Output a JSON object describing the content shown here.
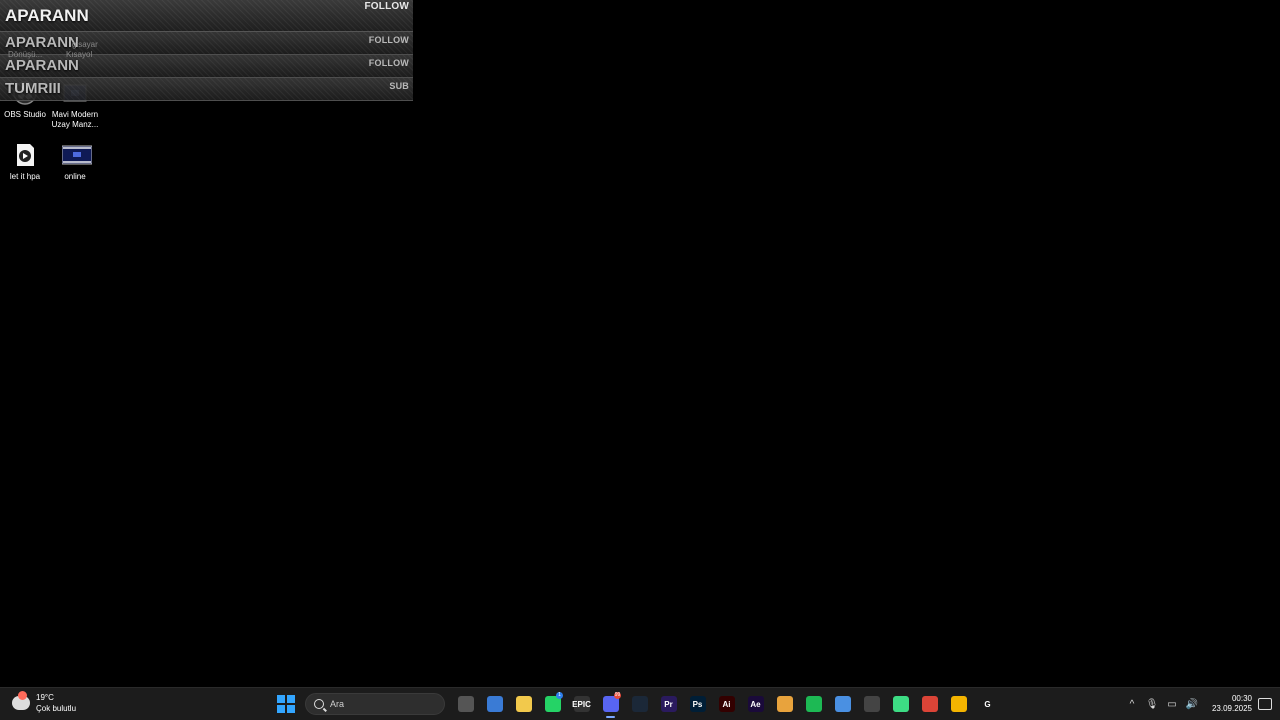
{
  "alerts": [
    {
      "name": "APARANN",
      "kind": "FOLLOW"
    },
    {
      "name": "APARANN",
      "kind": "FOLLOW"
    },
    {
      "name": "APARANN",
      "kind": "FOLLOW"
    },
    {
      "name": "TUMRIII",
      "kind": "SUB"
    }
  ],
  "ghost_labels": {
    "left": "Dönüşü...",
    "right": "Kısayol",
    "mid": "gisayar"
  },
  "desktop_icons": [
    {
      "label": "OBS Studio",
      "icon": "obs-icon"
    },
    {
      "label": "Mavi Modern Uzay Manz...",
      "icon": "video-file-icon"
    },
    {
      "label": "let it hpa",
      "icon": "media-file-icon"
    },
    {
      "label": "online",
      "icon": "video-file-icon"
    }
  ],
  "taskbar": {
    "weather": {
      "temp": "19°C",
      "desc": "Çok bulutlu"
    },
    "search_placeholder": "Ara",
    "apps": [
      {
        "name": "task-view",
        "icon": "task-view-icon",
        "text": "",
        "color": "#555555"
      },
      {
        "name": "store",
        "icon": "store-icon",
        "text": "",
        "color": "#3a7bd5"
      },
      {
        "name": "explorer",
        "icon": "folder-icon",
        "text": "",
        "color": "#f2c94c"
      },
      {
        "name": "whatsapp",
        "icon": "whatsapp-icon",
        "text": "",
        "color": "#25d366",
        "badge": "1"
      },
      {
        "name": "epic",
        "icon": "epic-games-icon",
        "text": "EPIC",
        "color": "#333333"
      },
      {
        "name": "discord",
        "icon": "discord-icon",
        "text": "",
        "color": "#5865f2",
        "badge": "99",
        "active": true
      },
      {
        "name": "steam",
        "icon": "steam-icon",
        "text": "",
        "color": "#1b2838"
      },
      {
        "name": "premiere",
        "icon": "premiere-icon",
        "text": "Pr",
        "color": "#2a1a5e"
      },
      {
        "name": "photoshop",
        "icon": "photoshop-icon",
        "text": "Ps",
        "color": "#001e36"
      },
      {
        "name": "illustrator",
        "icon": "illustrator-icon",
        "text": "Ai",
        "color": "#330000"
      },
      {
        "name": "aftereffects",
        "icon": "after-effects-icon",
        "text": "Ae",
        "color": "#1a0a3a"
      },
      {
        "name": "chrome-1",
        "icon": "chrome-icon",
        "text": "",
        "color": "#e8a33d"
      },
      {
        "name": "spotify",
        "icon": "spotify-icon",
        "text": "",
        "color": "#1db954"
      },
      {
        "name": "chrome-2",
        "icon": "chrome-icon",
        "text": "",
        "color": "#4a90e2"
      },
      {
        "name": "obs",
        "icon": "obs-icon",
        "text": "",
        "color": "#444444"
      },
      {
        "name": "app-green",
        "icon": "app-icon",
        "text": "",
        "color": "#3ddc84"
      },
      {
        "name": "chrome-3",
        "icon": "chrome-icon",
        "text": "",
        "color": "#db4437"
      },
      {
        "name": "chrome-4",
        "icon": "chrome-icon",
        "text": "",
        "color": "#f4b400"
      },
      {
        "name": "logitech",
        "icon": "logitech-icon",
        "text": "G",
        "color": "#1c1c1c"
      }
    ],
    "clock": {
      "time": "00:30",
      "date": "23.09.2025"
    }
  }
}
